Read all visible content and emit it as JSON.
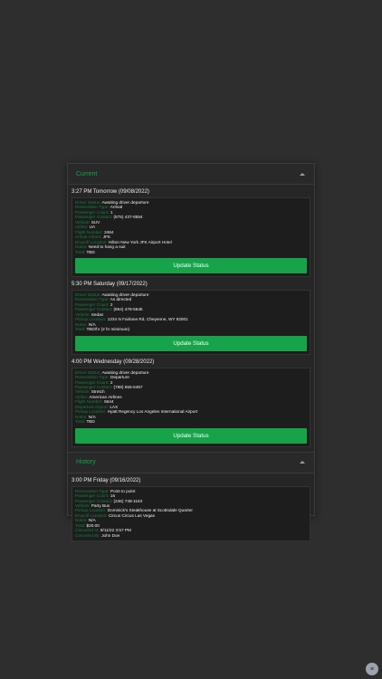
{
  "current": {
    "title": "Current",
    "items": [
      {
        "header": "3:27 PM Tomorrow (09/08/2022)",
        "rows": [
          {
            "label": "Driver Status:",
            "value": "Awaiting driver departure"
          },
          {
            "label": "Reservation Type:",
            "value": "Arrival"
          },
          {
            "label": "Passenger Count:",
            "value": "1"
          },
          {
            "label": "Passenger Contact:",
            "value": "(575) 437-8554"
          },
          {
            "label": "Vehicle:",
            "value": "SUV"
          },
          {
            "label": "Airline:",
            "value": "UA"
          },
          {
            "label": "Flight Number:",
            "value": "2484"
          },
          {
            "label": "Arrival Airport:",
            "value": "JFK"
          },
          {
            "label": "Dropoff Location:",
            "value": "Hilton New York JFK Airport Hotel"
          },
          {
            "label": "Notes:",
            "value": "Need to hang a suit"
          },
          {
            "label": "Total:",
            "value": "TBD"
          }
        ],
        "button": "Update Status"
      },
      {
        "header": "5:30 PM Saturday (09/17/2022)",
        "rows": [
          {
            "label": "Driver Status:",
            "value": "Awaiting driver departure"
          },
          {
            "label": "Reservation Type:",
            "value": "As directed"
          },
          {
            "label": "Passenger Count:",
            "value": "2"
          },
          {
            "label": "Passenger Contact:",
            "value": "(854) 478-5645"
          },
          {
            "label": "Vehicle:",
            "value": "Sedan"
          },
          {
            "label": "Pickup Location:",
            "value": "1234 N Fairlane Rd, Cheyenne, WY 82001"
          },
          {
            "label": "Notes:",
            "value": "N/A"
          },
          {
            "label": "Total:",
            "value": "TBD/hr (2 hr minimum)"
          }
        ],
        "button": "Update Status"
      },
      {
        "header": "4:00 PM Wednesday (09/28/2022)",
        "rows": [
          {
            "label": "Driver Status:",
            "value": "Awaiting driver departure"
          },
          {
            "label": "Reservation Type:",
            "value": "Departure"
          },
          {
            "label": "Passenger Count:",
            "value": "2"
          },
          {
            "label": "Passenger Contact:",
            "value": "(788) 655-6457"
          },
          {
            "label": "Vehicle:",
            "value": "Stretch"
          },
          {
            "label": "Airline:",
            "value": "American Airlines"
          },
          {
            "label": "Flight Number:",
            "value": "5644"
          },
          {
            "label": "Departure Airport:",
            "value": "LAX"
          },
          {
            "label": "Pickup Location:",
            "value": "Hyatt Regency Los Angeles International Airport"
          },
          {
            "label": "Notes:",
            "value": "N/A"
          },
          {
            "label": "Total:",
            "value": "TBD"
          }
        ],
        "button": "Update Status"
      }
    ]
  },
  "history": {
    "title": "History",
    "items": [
      {
        "header": "3:00 PM Friday (09/16/2022)",
        "rows": [
          {
            "label": "Reservation Type:",
            "value": "Point to point"
          },
          {
            "label": "Passenger Count:",
            "value": "16"
          },
          {
            "label": "Passenger Contact:",
            "value": "(246) 748-1163"
          },
          {
            "label": "Vehicle:",
            "value": "Party Bus"
          },
          {
            "label": "Pickup Location:",
            "value": "Dominick's Steakhouse at Scottsdale Quarter"
          },
          {
            "label": "Dropoff Location:",
            "value": "Circus Circus Las Vegas"
          },
          {
            "label": "Notes:",
            "value": "N/A"
          },
          {
            "label": "Total:",
            "value": "$20.00"
          },
          {
            "label": "Canceled At:",
            "value": "8/11/22 3:57 PM"
          },
          {
            "label": "Canceled By:",
            "value": "John Doe"
          }
        ]
      }
    ]
  },
  "fab": {
    "icon": "menu-icon",
    "glyph": "≡"
  },
  "colors": {
    "accent": "#16a34a",
    "label": "#15803d",
    "background": "#2e2e2e"
  }
}
